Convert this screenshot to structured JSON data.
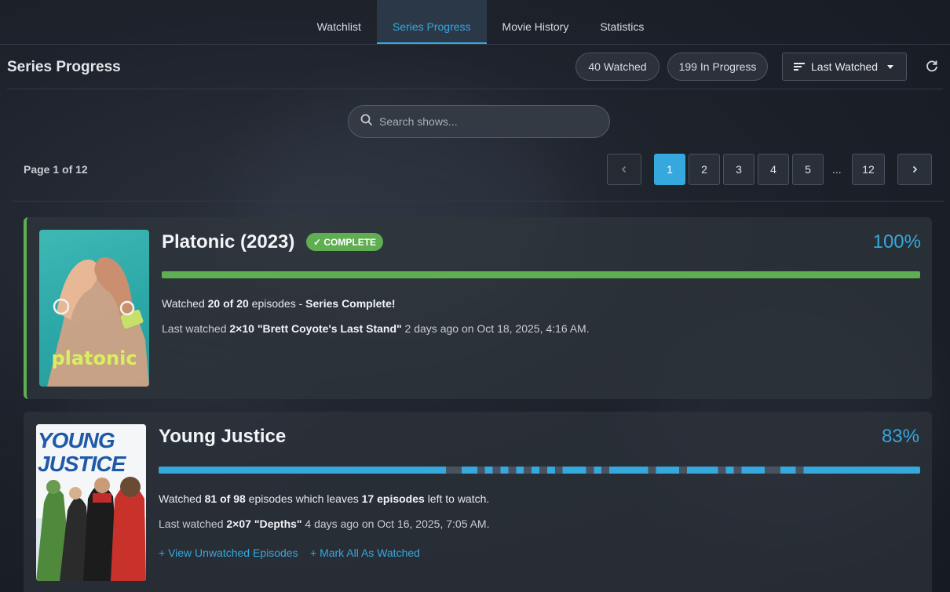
{
  "nav": {
    "tabs": [
      {
        "label": "Watchlist"
      },
      {
        "label": "Series Progress"
      },
      {
        "label": "Movie History"
      },
      {
        "label": "Statistics"
      }
    ],
    "active_tab": "Series Progress"
  },
  "header": {
    "title": "Series Progress",
    "watched_pill": "40 Watched",
    "in_progress_pill": "199 In Progress",
    "sort_label": "Last Watched"
  },
  "search": {
    "placeholder": "Search shows..."
  },
  "pagination": {
    "info": "Page 1 of 12",
    "pages": [
      "1",
      "2",
      "3",
      "4",
      "5"
    ],
    "ellipsis": "...",
    "last_page": "12",
    "current": "1"
  },
  "shows": [
    {
      "title": "Platonic (2023)",
      "badge": "✓ COMPLETE",
      "percent_label": "100%",
      "progress": 1.0,
      "bar_color": "#5fae52",
      "watched_prefix": "Watched ",
      "watched_count": "20 of 20",
      "watched_mid": " episodes - ",
      "watched_suffix_bold": "Series Complete!",
      "last_prefix": "Last watched ",
      "last_episode": "2×10 \"Brett Coyote's Last Stand\"",
      "last_time": " 2 days ago on Oct 18, 2025, 4:16 AM.",
      "poster_text": "platonic"
    },
    {
      "title": "Young Justice",
      "percent_label": "83%",
      "progress": 0.83,
      "bar_color": "#35a8dd",
      "gap_color": "#4a5260",
      "watched_prefix": "Watched ",
      "watched_count": "81 of 98",
      "watched_mid": " episodes which leaves ",
      "watched_left": "17 episodes",
      "watched_end": " left to watch.",
      "last_prefix": "Last watched ",
      "last_episode": "2×07 \"Depths\"",
      "last_time": " 4 days ago on Oct 16, 2025, 7:05 AM.",
      "view_unwatched": "+ View Unwatched Episodes",
      "mark_all": "+ Mark All As Watched",
      "poster_text_1": "YOUNG",
      "poster_text_2": "JUSTICE",
      "unwatched_episode_indices": [
        37,
        38,
        41,
        43,
        45,
        47,
        49,
        51,
        55,
        57,
        63,
        67,
        72,
        74,
        78,
        79,
        82
      ]
    }
  ],
  "colors": {
    "accent": "#35a8dd",
    "complete": "#5fae52"
  }
}
